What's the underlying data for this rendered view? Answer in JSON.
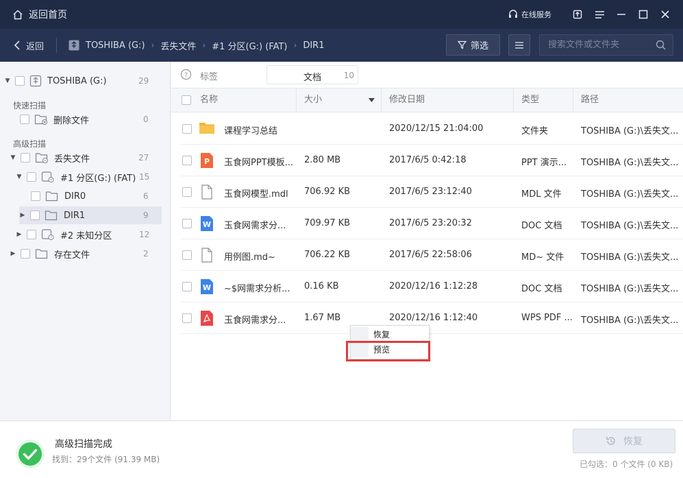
{
  "titlebar": {
    "home_label": "返回首页",
    "service_label": "在线服务"
  },
  "navbar": {
    "back_label": "返回",
    "breadcrumbs": [
      "TOSHIBA (G:)",
      "丢失文件",
      "#1 分区(G:) (FAT)",
      "DIR1"
    ],
    "filter_label": "筛选",
    "search_placeholder": "搜索文件或文件夹"
  },
  "sidebar": {
    "root": {
      "label": "TOSHIBA (G:)",
      "count": "29"
    },
    "section_quick": "快速扫描",
    "deleted": {
      "label": "删除文件",
      "count": "0"
    },
    "section_advanced": "高级扫描",
    "lost": {
      "label": "丢失文件",
      "count": "27"
    },
    "part1": {
      "label": "#1 分区(G:) (FAT)",
      "count": "15"
    },
    "dir0": {
      "label": "DIR0",
      "count": "6"
    },
    "dir1": {
      "label": "DIR1",
      "count": "9"
    },
    "part2": {
      "label": "#2 未知分区",
      "count": "12"
    },
    "existing": {
      "label": "存在文件",
      "count": "2"
    }
  },
  "tagbar": {
    "label": "标签",
    "tag_name": "文档",
    "tag_count": "10"
  },
  "table": {
    "headers": {
      "name": "名称",
      "size": "大小",
      "date": "修改日期",
      "type": "类型",
      "path": "路径"
    },
    "rows": [
      {
        "icon": "folder-icon",
        "name": "课程学习总结",
        "size": "",
        "date": "2020/12/15 21:04:00",
        "type": "文件夹",
        "path": "TOSHIBA (G:)\\丢失文..."
      },
      {
        "icon": "ppt-icon",
        "name": "玉食网PPT模板...",
        "size": "2.80 MB",
        "date": "2017/6/5 0:42:18",
        "type": "PPT 演示...",
        "path": "TOSHIBA (G:)\\丢失文..."
      },
      {
        "icon": "file-icon",
        "name": "玉食网模型.mdl",
        "size": "706.92 KB",
        "date": "2017/6/5 23:12:40",
        "type": "MDL 文件",
        "path": "TOSHIBA (G:)\\丢失文..."
      },
      {
        "icon": "doc-icon",
        "name": "玉食网需求分...",
        "size": "709.97 KB",
        "date": "2017/6/5 23:20:32",
        "type": "DOC 文档",
        "path": "TOSHIBA (G:)\\丢失文..."
      },
      {
        "icon": "file-icon",
        "name": "用例图.md~",
        "size": "706.22 KB",
        "date": "2017/6/5 22:58:06",
        "type": "MD~ 文件",
        "path": "TOSHIBA (G:)\\丢失文..."
      },
      {
        "icon": "doc-icon",
        "name": "~$网需求分析...",
        "size": "0.16 KB",
        "date": "2020/12/16 1:12:28",
        "type": "DOC 文档",
        "path": "TOSHIBA (G:)\\丢失文..."
      },
      {
        "icon": "pdf-icon",
        "name": "玉食网需求分...",
        "size": "1.67 MB",
        "date": "2020/12/16 1:12:40",
        "type": "WPS PDF ...",
        "path": "TOSHIBA (G:)\\丢失文..."
      }
    ]
  },
  "context_menu": {
    "recover": "恢复",
    "preview": "预览"
  },
  "footer": {
    "status": "高级扫描完成",
    "found": "找到：29个文件 (91.39 MB)",
    "recover_label": "恢复",
    "selected": "已勾选：0 个文件 (0 KB)"
  },
  "colors": {
    "titlebar": "#1f2a44",
    "navbar": "#263352",
    "highlight": "#e23b3b",
    "success": "#3bbf5a"
  }
}
